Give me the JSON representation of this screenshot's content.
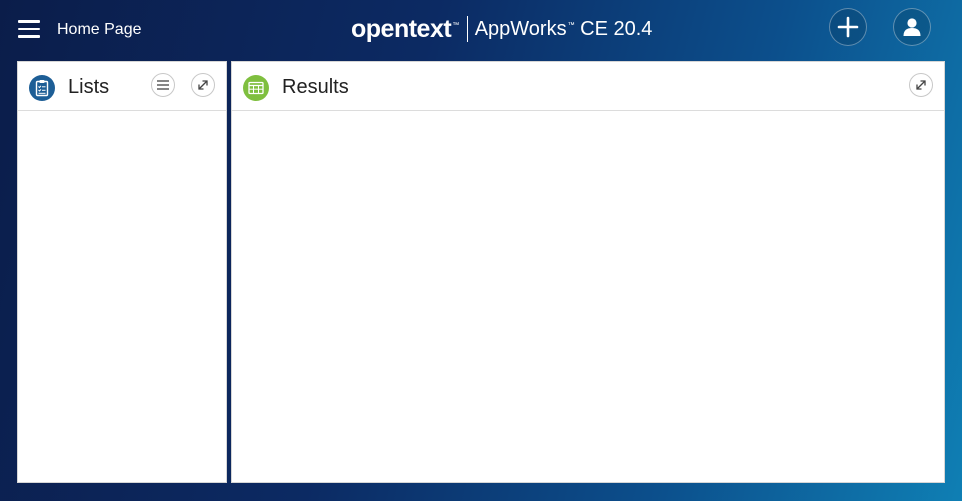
{
  "header": {
    "menu_icon": "hamburger-icon",
    "page_title": "Home Page",
    "brand_logo": "opentext",
    "brand_tm": "™",
    "product_name": "AppWorks",
    "product_tm": "™",
    "product_version": " CE 20.4",
    "add_icon": "plus-icon",
    "user_icon": "user-icon"
  },
  "panels": {
    "lists": {
      "title": "Lists",
      "icon": "clipboard-list-icon",
      "menu_icon": "list-menu-icon",
      "expand_icon": "expand-icon",
      "icon_color": "#1d5e96"
    },
    "results": {
      "title": "Results",
      "icon": "table-icon",
      "expand_icon": "expand-icon",
      "icon_color": "#7fbf3f"
    }
  },
  "colors": {
    "header_gradient_start": "#0b1d4a",
    "header_gradient_end": "#0f7fb4",
    "panel_bg": "#ffffff"
  }
}
